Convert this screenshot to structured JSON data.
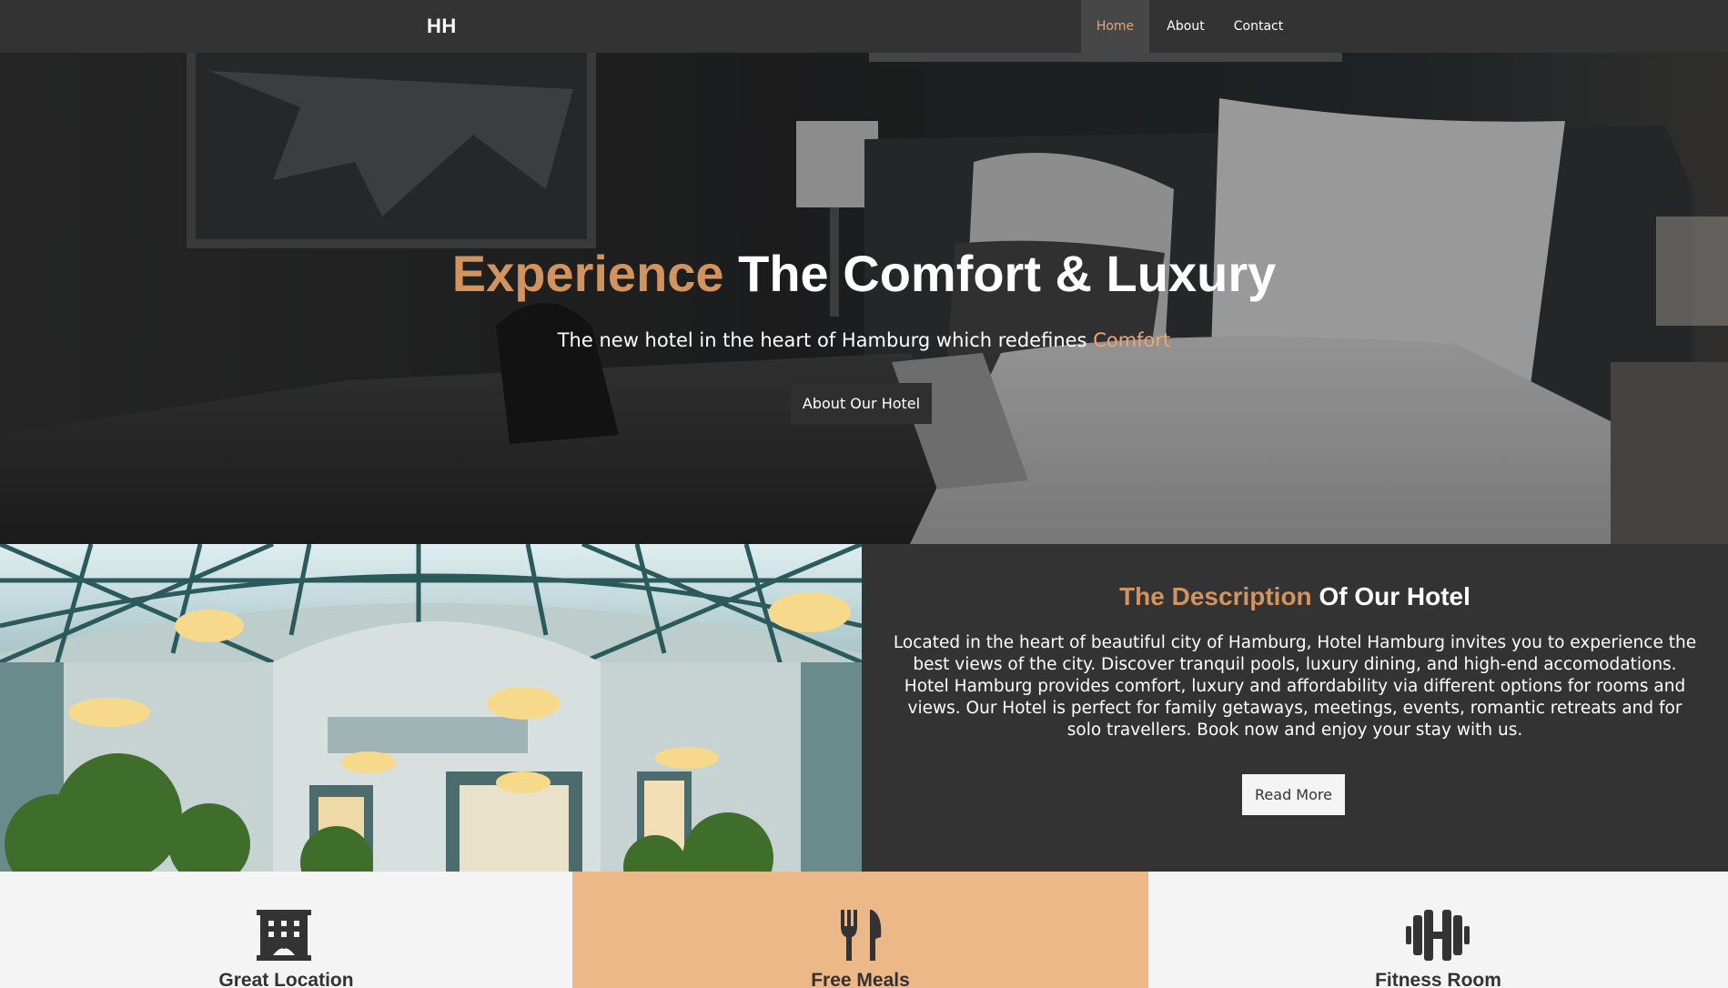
{
  "nav": {
    "brand": "HH",
    "links": [
      {
        "label": "Home",
        "active": true
      },
      {
        "label": "About",
        "active": false
      },
      {
        "label": "Contact",
        "active": false
      }
    ]
  },
  "hero": {
    "title_accent": "Experience",
    "title_rest": "The Comfort & Luxury",
    "subtitle_main": "The new hotel in the heart of Hamburg which redefines",
    "subtitle_accent": "Comfort",
    "button_label": "About Our Hotel"
  },
  "about": {
    "title_accent": "The Description",
    "title_rest": "Of Our Hotel",
    "text": "Located in the heart of beautiful city of Hamburg, Hotel Hamburg invites you to experience the best views of the city. Discover tranquil pools, luxury dining, and high-end accomodations. Hotel Hamburg provides comfort, luxury and affordability via different options for rooms and views. Our Hotel is perfect for family getaways, meetings, events, romantic retreats and for solo travellers. Book now and enjoy your stay with us.",
    "button_label": "Read More"
  },
  "features": [
    {
      "label": "Great Location",
      "icon": "hotel-building-icon"
    },
    {
      "label": "Free Meals",
      "icon": "fork-knife-icon"
    },
    {
      "label": "Fitness Room",
      "icon": "dumbbell-icon"
    }
  ],
  "colors": {
    "accent": "#d3935e",
    "nav_bg": "#333333",
    "feature_highlight": "#ecb887"
  }
}
